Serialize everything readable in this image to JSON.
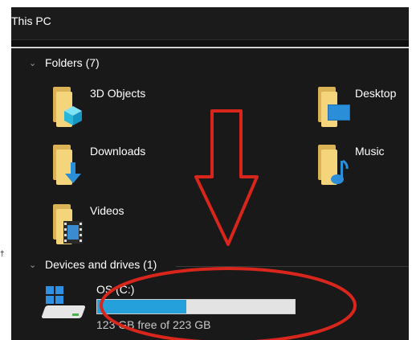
{
  "window": {
    "title": "This PC"
  },
  "folders_group": {
    "label": "Folders (7)",
    "items": [
      {
        "label": "3D Objects",
        "icon": "3d-objects-folder-icon"
      },
      {
        "label": "Desktop",
        "icon": "desktop-folder-icon"
      },
      {
        "label": "Downloads",
        "icon": "downloads-folder-icon"
      },
      {
        "label": "Music",
        "icon": "music-folder-icon"
      },
      {
        "label": "Videos",
        "icon": "videos-folder-icon"
      }
    ]
  },
  "drives_group": {
    "label": "Devices and drives (1)",
    "drives": [
      {
        "name": "OS (C:)",
        "free_text": "123 GB free of 223 GB",
        "used_fraction": 0.45,
        "icon": "windows-drive-icon"
      }
    ]
  },
  "annotations": {
    "arrow": "red-down-arrow-annotation",
    "circle": "red-ellipse-annotation",
    "color": "#d9261c"
  },
  "colors": {
    "background": "#191919",
    "titlebar": "#1b1b1b",
    "progress": "#26a0da",
    "progress_track": "#e3e3e3",
    "folder": "#f4d57b"
  }
}
